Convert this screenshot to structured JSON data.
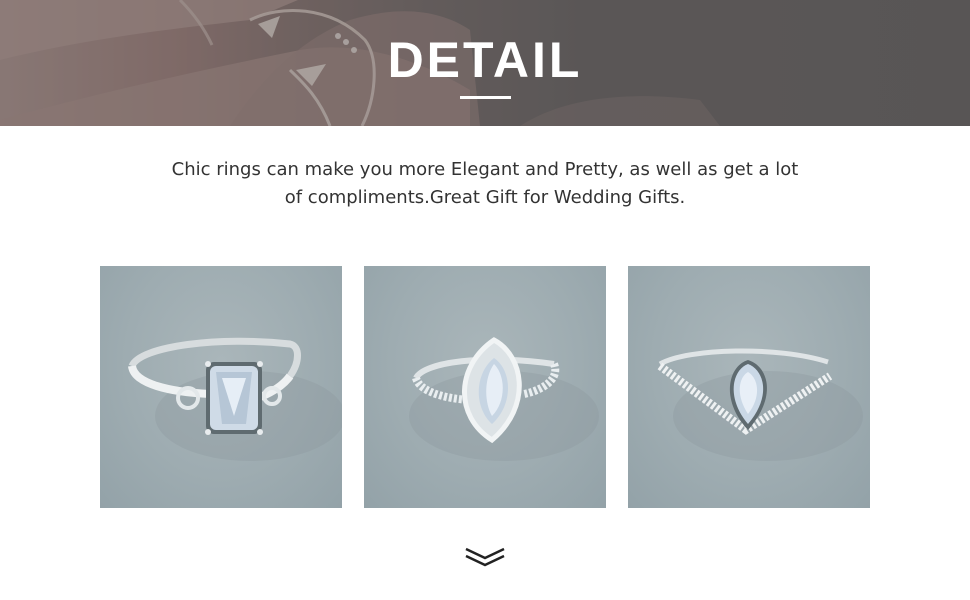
{
  "banner": {
    "title": "DETAIL"
  },
  "description": {
    "line1": "Chic rings can make you more Elegant and Pretty, as well as get a lot",
    "line2": "of compliments.Great Gift for Wedding Gifts."
  },
  "products": [
    {
      "name": "emerald-cut-solitaire-ring"
    },
    {
      "name": "marquise-halo-ring"
    },
    {
      "name": "pear-chevron-ring"
    }
  ],
  "icons": {
    "scroll": "double-chevron-down-icon"
  },
  "colors": {
    "banner_overlay": "#6a6868",
    "text": "#333333",
    "photo_background": "#9eacb1",
    "metal": "#e6e9ea",
    "gem": "#c9d6e4"
  }
}
